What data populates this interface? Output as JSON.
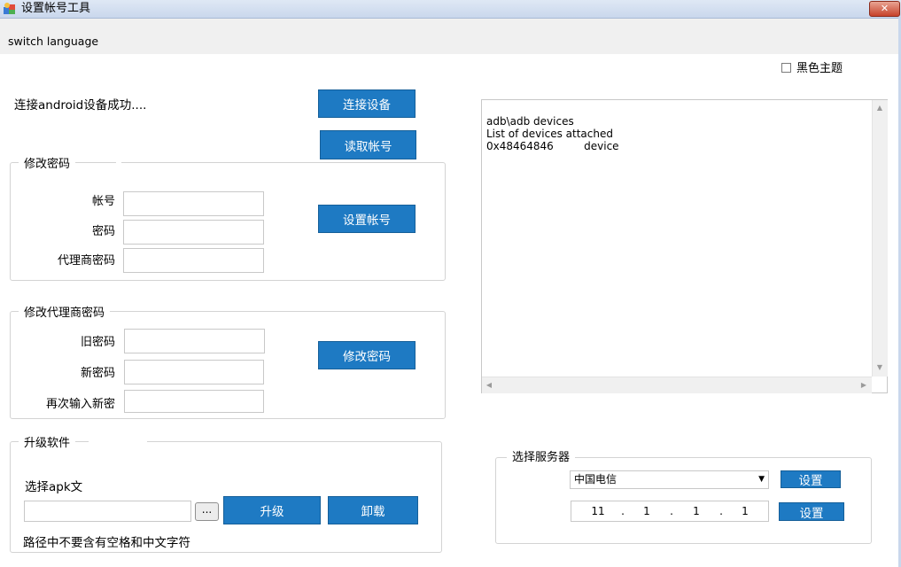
{
  "window": {
    "title": "设置帐号工具",
    "close_label": "✕"
  },
  "menu": {
    "switch_language": "switch language"
  },
  "theme": {
    "dark_label": "黑色主题",
    "checked": false
  },
  "status": {
    "text": "连接android设备成功...."
  },
  "buttons": {
    "connect": "连接设备",
    "read_account": "读取帐号",
    "set_account": "设置帐号",
    "change_password": "修改密码",
    "upgrade": "升级",
    "uninstall": "卸载",
    "browse": "...",
    "server_set_1": "设置",
    "server_set_2": "设置"
  },
  "change_password_group": {
    "legend": "修改密码",
    "account_label": "帐号",
    "password_label": "密码",
    "agent_password_label": "代理商密码",
    "account_value": "",
    "password_value": "",
    "agent_password_value": ""
  },
  "change_agent_group": {
    "legend": "修改代理商密码",
    "old_label": "旧密码",
    "new_label": "新密码",
    "confirm_label": "再次输入新密",
    "old_value": "",
    "new_value": "",
    "confirm_value": ""
  },
  "upgrade_group": {
    "legend": "升级软件",
    "select_apk_label": "选择apk文",
    "apk_path_value": "",
    "note": "路径中不要含有空格和中文字符"
  },
  "console": {
    "line1": "adb\\adb devices",
    "line2": "List of devices attached",
    "line3": "0x48464846         device"
  },
  "server_group": {
    "legend": "选择服务器",
    "selected": "中国电信",
    "ip": [
      "11",
      "1",
      "1",
      "1"
    ],
    "ip_sep": "."
  },
  "icons": {
    "app": "app-icon",
    "dropdown": "chevron-down-icon",
    "scroll_up": "scroll-up-icon",
    "scroll_down": "scroll-down-icon",
    "scroll_left": "scroll-left-icon",
    "scroll_right": "scroll-right-icon"
  },
  "colors": {
    "accent": "#1e7ac3",
    "titlebar": "#c9d7ec",
    "close": "#c7422a"
  }
}
